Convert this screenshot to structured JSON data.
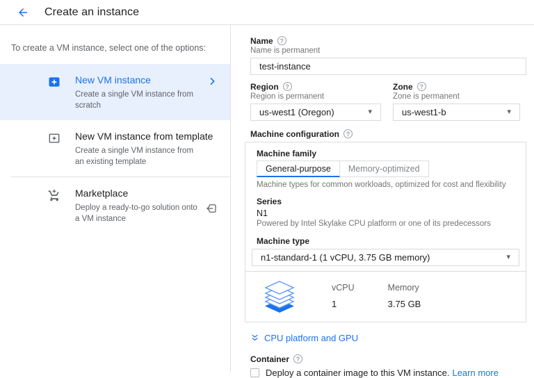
{
  "header": {
    "title": "Create an instance"
  },
  "sidebar": {
    "intro": "To create a VM instance, select one of the options:",
    "items": [
      {
        "title": "New VM instance",
        "subtitle": "Create a single VM instance from scratch",
        "active": true
      },
      {
        "title": "New VM instance from template",
        "subtitle": "Create a single VM instance from\nan existing template"
      },
      {
        "title": "Marketplace",
        "subtitle": "Deploy a ready-to-go solution onto\na VM instance"
      }
    ]
  },
  "form": {
    "name": {
      "label": "Name",
      "helper": "Name is permanent",
      "value": "test-instance"
    },
    "region": {
      "label": "Region",
      "helper": "Region is permanent",
      "value": "us-west1 (Oregon)"
    },
    "zone": {
      "label": "Zone",
      "helper": "Zone is permanent",
      "value": "us-west1-b"
    },
    "machine_configuration": {
      "label": "Machine configuration",
      "machine_family": {
        "label": "Machine family",
        "tabs": [
          "General-purpose",
          "Memory-optimized"
        ],
        "active_tab": "General-purpose",
        "helper": "Machine types for common workloads, optimized for cost and flexibility"
      },
      "series": {
        "label": "Series",
        "value": "N1",
        "helper": "Powered by Intel Skylake CPU platform or one of its predecessors"
      },
      "machine_type": {
        "label": "Machine type",
        "value": "n1-standard-1 (1 vCPU, 3.75 GB memory)"
      },
      "stats": {
        "vcpu_label": "vCPU",
        "vcpu_value": "1",
        "memory_label": "Memory",
        "memory_value": "3.75 GB"
      }
    },
    "cpu_platform_link": "CPU platform and GPU",
    "container": {
      "label": "Container",
      "checkbox_text": "Deploy a container image to this VM instance.",
      "link": "Learn more",
      "checked": false
    }
  },
  "icons": {
    "help_glyph": "?",
    "dropdown_caret": "▾"
  },
  "colors": {
    "accent_blue": "#1a73e8",
    "active_item_bg": "#e8f0fe",
    "text_dark": "#202124",
    "text_gray": "#5f6368",
    "border": "#dcdcdc",
    "stack_light_blue": "#669df6"
  }
}
